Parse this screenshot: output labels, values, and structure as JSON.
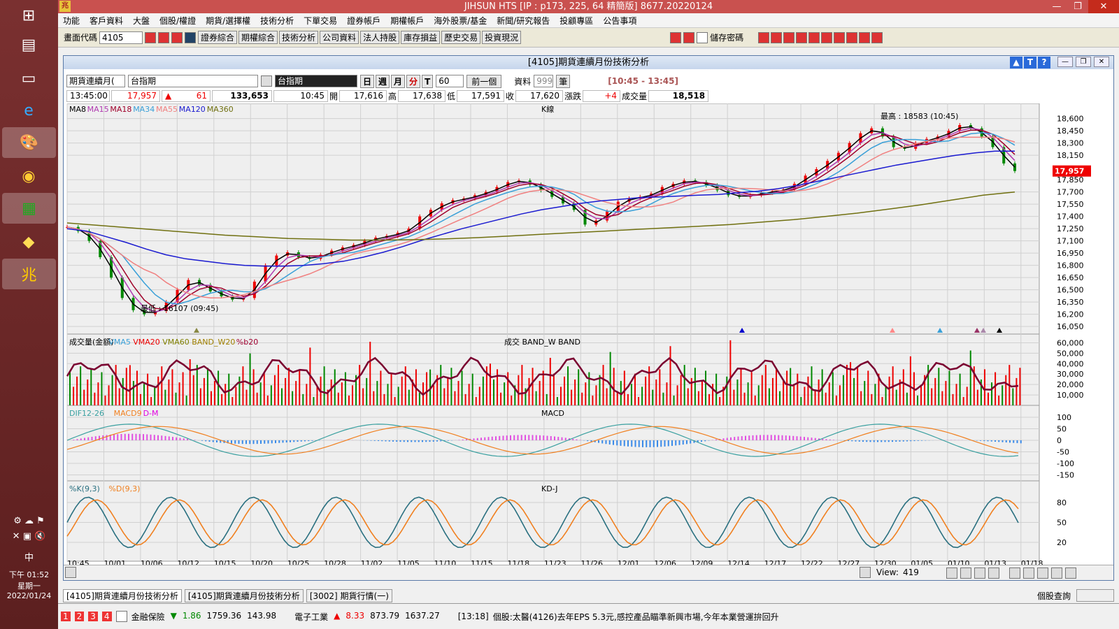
{
  "taskbar": {
    "icons": [
      "windows-logo-icon",
      "file-explorer-icon",
      "folder-icon",
      "ie-icon",
      "paint-icon",
      "chrome-icon",
      "excel-icon",
      "folder2-icon",
      "jihsun-app-icon"
    ],
    "clock": {
      "time": "下午 01:52",
      "weekday": "星期一",
      "date": "2022/01/24"
    },
    "ime": "中"
  },
  "window": {
    "title": "JIHSUN HTS    [IP : p173, 225, 64 精簡版] 8677.20220124"
  },
  "menu": [
    "功能",
    "客戶資料",
    "大盤",
    "個股/權證",
    "期貨/選擇權",
    "技術分析",
    "下單交易",
    "證券帳戶",
    "期權帳戶",
    "海外股票/基金",
    "新聞/研究報告",
    "投顧專區",
    "公告事項"
  ],
  "toolbar": {
    "code_label": "畫面代碼",
    "code_value": "4105",
    "buttons": [
      "證券綜合",
      "期權綜合",
      "技術分析",
      "公司資料",
      "法人持股",
      "庫存損益",
      "歷史交易",
      "投資現況"
    ],
    "save_pw": "儲存密碼"
  },
  "subwindow": {
    "title": "[4105]期貨連續月份技術分析",
    "time_range": "[10:45 - 13:45]",
    "type_select": "期貨連續月(",
    "symbol_select": "台指期",
    "symbol_name": "台指期",
    "periods": [
      "日",
      "週",
      "月",
      "分",
      "T"
    ],
    "interval": "60",
    "prev_btn": "前一個",
    "data_label": "資料",
    "data_count": "999",
    "unit": "筆"
  },
  "quote": {
    "time": "13:45:00",
    "price": "17,957",
    "change": "61",
    "volume_total": "133,653",
    "bar_time": "10:45",
    "open_label": "開",
    "open": "17,616",
    "high_label": "高",
    "high": "17,638",
    "low_label": "低",
    "low": "17,591",
    "close_label": "收",
    "close": "17,620",
    "chg_label": "漲跌",
    "chg": "+4",
    "vol_label": "成交量",
    "vol": "18,518"
  },
  "chart_data": {
    "type": "line",
    "panels": {
      "k": {
        "title": "K線",
        "legend": [
          "MA8",
          "MA15",
          "MA18",
          "MA34",
          "MA55",
          "MA120",
          "MA360"
        ],
        "legend_colors": [
          "#000000",
          "#b03ab0",
          "#a0002a",
          "#3aa0d8",
          "#f08080",
          "#1a1ad0",
          "#707010"
        ],
        "yticks": [
          18600,
          18450,
          18300,
          18150,
          17850,
          17700,
          17550,
          17400,
          17250,
          17100,
          16950,
          16800,
          16650,
          16500,
          16350,
          16200,
          16050
        ],
        "current_price": "17,957",
        "high_note": "最高 : 18583 (10:45)",
        "low_note": "最低 : 16107 (09:45)",
        "close": [
          17270,
          17220,
          17100,
          16900,
          16650,
          16400,
          16250,
          16200,
          16240,
          16350,
          16500,
          16620,
          16560,
          16480,
          16420,
          16380,
          16400,
          16600,
          16800,
          16920,
          16960,
          16900,
          16880,
          16930,
          16980,
          17020,
          17050,
          17100,
          17140,
          17160,
          17200,
          17250,
          17400,
          17480,
          17560,
          17600,
          17620,
          17660,
          17700,
          17760,
          17820,
          17840,
          17790,
          17720,
          17640,
          17560,
          17480,
          17300,
          17350,
          17460,
          17580,
          17620,
          17640,
          17680,
          17760,
          17800,
          17840,
          17820,
          17780,
          17720,
          17660,
          17640,
          17660,
          17690,
          17710,
          17730,
          17800,
          17900,
          17980,
          18080,
          18180,
          18300,
          18420,
          18480,
          18380,
          18250,
          18230,
          18300,
          18350,
          18380,
          18450,
          18520,
          18480,
          18380,
          18250,
          18050,
          17957
        ],
        "ma120": [
          17250,
          17220,
          17150,
          17080,
          17000,
          16930,
          16880,
          16850,
          16820,
          16800,
          16790,
          16790,
          16800,
          16820,
          16850,
          16900,
          16960,
          17030,
          17110,
          17180,
          17250,
          17310,
          17370,
          17430,
          17480,
          17520,
          17560,
          17590,
          17610,
          17630,
          17640,
          17650,
          17660,
          17670,
          17690,
          17710,
          17740,
          17780,
          17830,
          17880,
          17930,
          17980,
          18030,
          18070,
          18110,
          18150,
          18180,
          18200,
          18200
        ],
        "ma360": [
          17320,
          17290,
          17260,
          17230,
          17200,
          17170,
          17150,
          17130,
          17120,
          17110,
          17110,
          17115,
          17125,
          17140,
          17160,
          17180,
          17200,
          17220,
          17240,
          17260,
          17280,
          17300,
          17330,
          17360,
          17400,
          17440,
          17490,
          17540,
          17600,
          17660,
          17700
        ]
      },
      "vol": {
        "title": "成交",
        "legend": [
          "成交量(金額)",
          "VMA5",
          "VMA20",
          "VMA60",
          "BAND_W20",
          "%b20"
        ],
        "extra": "BAND_W   BAND",
        "yticks": [
          60000,
          50000,
          40000,
          30000,
          20000,
          10000
        ]
      },
      "macd": {
        "title": "MACD",
        "legend": [
          "DIF12-26",
          "MACD9",
          "D-M"
        ],
        "yticks": [
          100,
          50,
          0,
          -50,
          -100,
          -150
        ]
      },
      "kd": {
        "title": "KD-J",
        "legend": [
          "%K(9,3)",
          "%D(9,3)"
        ],
        "yticks": [
          80,
          50,
          20
        ]
      }
    },
    "x_ticks": [
      "10:45",
      "10/01",
      "10/06",
      "10/12",
      "10/15",
      "10/20",
      "10/25",
      "10/28",
      "11/02",
      "11/05",
      "11/10",
      "11/15",
      "11/18",
      "11/23",
      "11/26",
      "12/01",
      "12/06",
      "12/09",
      "12/14",
      "12/17",
      "12/22",
      "12/27",
      "12/30",
      "01/05",
      "01/10",
      "01/13",
      "01/18"
    ]
  },
  "status": {
    "view_label": "View:",
    "view_value": "419"
  },
  "tabs": [
    "[4105]期貨連續月份技術分析",
    "[4105]期貨連續月份技術分析",
    "[3002]  期貨行情(一)"
  ],
  "tabs_right": "個股查詢",
  "ticker": {
    "pages": [
      "1",
      "2",
      "3",
      "4"
    ],
    "item1_name": "金融保險",
    "item1_chg": "1.86",
    "item1_price": "1759.36",
    "item1_vol": "143.98",
    "item2_name": "電子工業",
    "item2_chg": "8.33",
    "item2_price": "873.79",
    "item2_vol": "1637.27",
    "news_time": "[13:18]",
    "news_text": "個股:太醫(4126)去年EPS 5.3元,感控產品瞄準新興市場,今年本業營運拚回升"
  }
}
